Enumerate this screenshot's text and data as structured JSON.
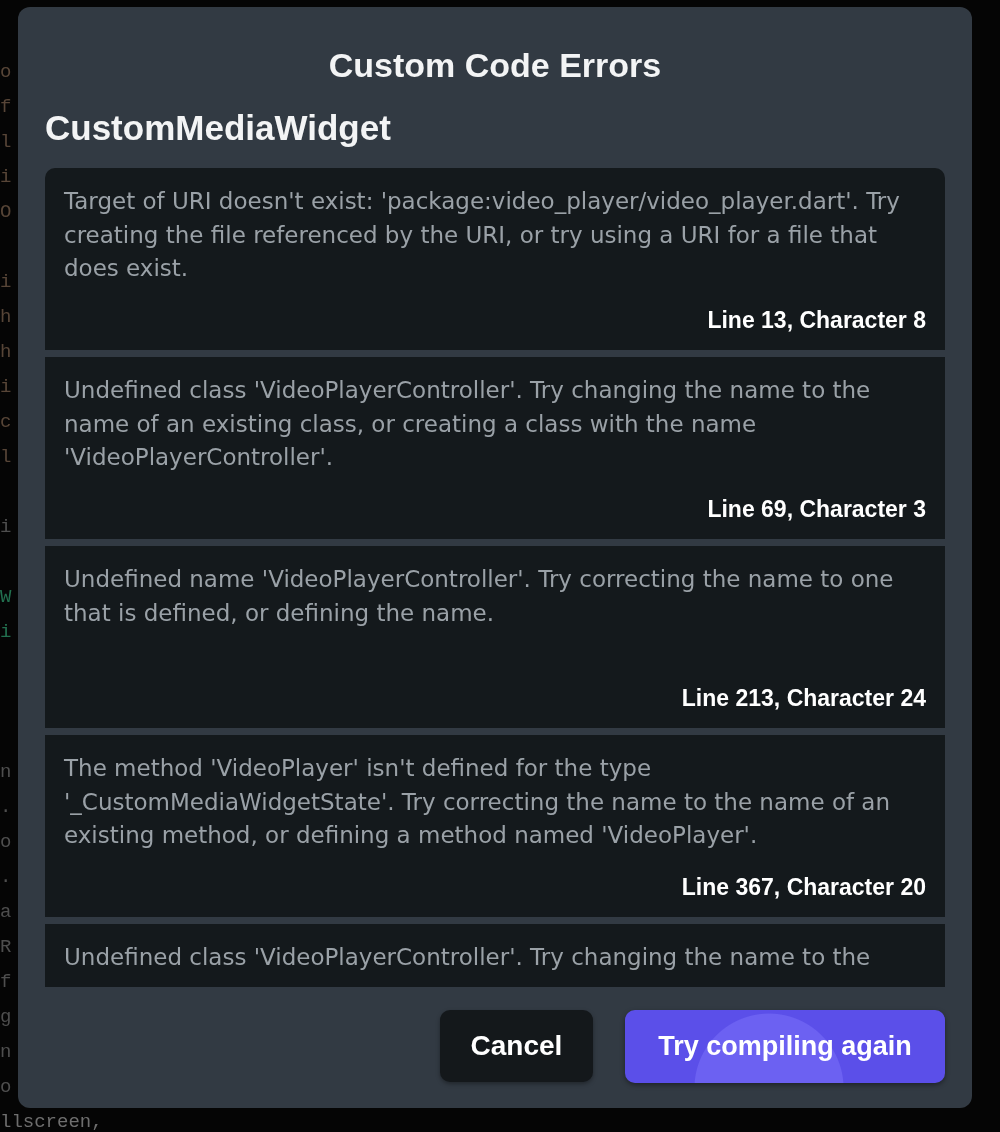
{
  "editor_background": {
    "blocks": [
      {
        "color": "#574537",
        "lines": [
          {
            "text": "o"
          },
          {
            "text": "f"
          },
          {
            "text": "l"
          },
          {
            "text": "i"
          },
          {
            "text": "O"
          }
        ]
      },
      {
        "color": "#574537",
        "lines": [
          {
            "text": "i"
          },
          {
            "text": "h"
          },
          {
            "text": "h"
          },
          {
            "text": "i"
          },
          {
            "text": "c"
          },
          {
            "text": "l"
          }
        ]
      },
      {
        "color": "#4e4e4e",
        "lines": [
          {
            "text": "i"
          }
        ]
      },
      {
        "color": "#22704f",
        "lines": [
          {
            "text": "W"
          },
          {
            "text": "i"
          }
        ]
      },
      {
        "color": "#4e4e4e",
        "lines": [
          {
            "text": "n"
          },
          {
            "text": "."
          },
          {
            "text": "o"
          },
          {
            "text": "."
          },
          {
            "text": "a"
          },
          {
            "text": "R"
          },
          {
            "text": "f"
          },
          {
            "text": "g"
          },
          {
            "text": "n"
          },
          {
            "text": "o"
          }
        ]
      },
      {
        "color": "#6e6e6e",
        "lines": [
          {
            "text": "llscreen,"
          }
        ]
      }
    ]
  },
  "dialog": {
    "title": "Custom Code Errors",
    "widget_name": "CustomMediaWidget",
    "errors": [
      {
        "message_lines": [
          "Target of URI doesn't exist: 'package:video_player/video_player.dart'. Try",
          "creating the file referenced by the URI, or try using a URI for a file that",
          "does exist."
        ],
        "location": "Line 13, Character 8"
      },
      {
        "message_lines": [
          "Undefined class 'VideoPlayerController'. Try changing the name to the",
          "name of an existing class, or creating a class with the name",
          "'VideoPlayerController'."
        ],
        "location": "Line 69, Character 3"
      },
      {
        "message_lines": [
          "Undefined name 'VideoPlayerController'. Try correcting the name to one",
          "that is defined, or defining the name."
        ],
        "location": "Line 213, Character 24"
      },
      {
        "message_lines": [
          "The method 'VideoPlayer' isn't defined for the type",
          "'_CustomMediaWidgetState'. Try correcting the name to the name of an",
          "existing method, or defining a method named 'VideoPlayer'."
        ],
        "location": "Line 367, Character 20"
      },
      {
        "message_lines": [
          "Undefined class 'VideoPlayerController'. Try changing the name to the"
        ]
      }
    ],
    "buttons": [
      {
        "label": "Cancel",
        "kind": "secondary"
      },
      {
        "label": "Try compiling again",
        "kind": "primary"
      }
    ]
  }
}
